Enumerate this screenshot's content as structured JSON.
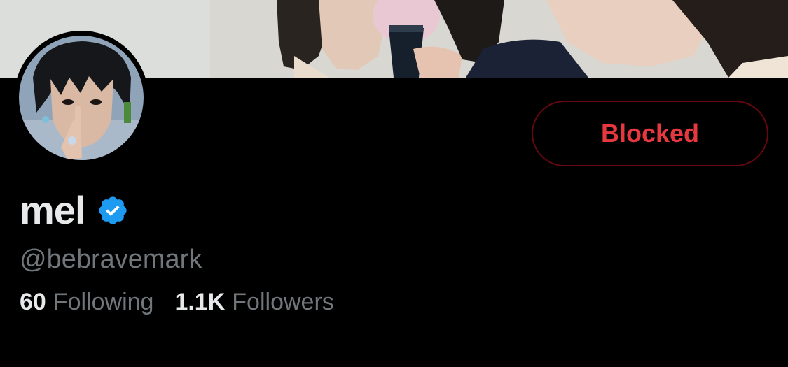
{
  "profile": {
    "display_name": "mel",
    "verified_icon": "verified-badge-icon",
    "handle": "@bebravemark",
    "banner_image": "banner-photo",
    "avatar_image": "avatar-photo"
  },
  "actions": {
    "blocked_label": "Blocked"
  },
  "stats": {
    "following_count": "60",
    "following_label": "Following",
    "followers_count": "1.1K",
    "followers_label": "Followers"
  },
  "colors": {
    "background": "#000000",
    "primary_text": "#e7e9ea",
    "secondary_text": "#71767b",
    "blocked_red": "#f4212e",
    "blocked_border": "#67070f",
    "verified_blue": "#1d9bf0"
  }
}
